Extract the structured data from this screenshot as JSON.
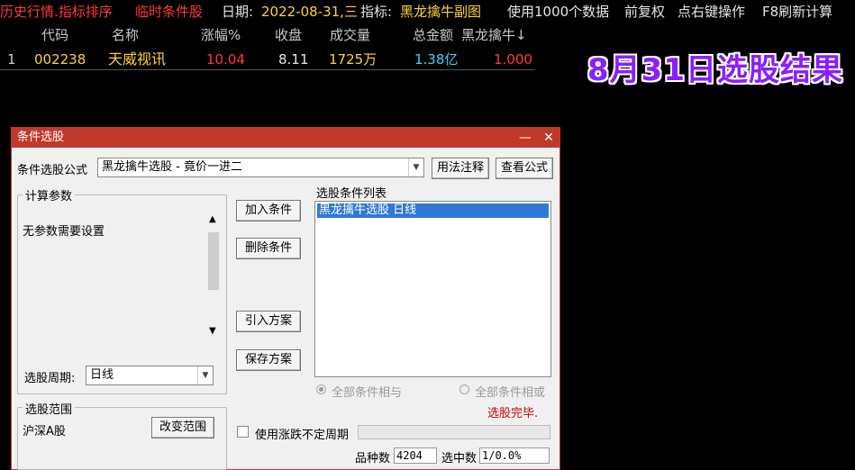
{
  "topbar": {
    "history": "历史行情.指标排序",
    "temp_cond": "临时条件股",
    "date_label": "日期:",
    "date_value": "2022-08-31,三",
    "indicator_label": "指标:",
    "indicator_value": "黑龙擒牛副图",
    "data_count": "使用1000个数据",
    "fq": "前复权",
    "right_click": "点右键操作",
    "f8": "F8刷新计算"
  },
  "table": {
    "headers": [
      "代码",
      "名称",
      "涨幅%",
      "收盘",
      "成交量",
      "总金额",
      "黑龙擒牛↓"
    ],
    "rows": [
      {
        "idx": "1",
        "code": "002238",
        "name": "天威视讯",
        "change": "10.04",
        "close": "8.11",
        "volume": "1725万",
        "amount": "1.38亿",
        "indicator": "1.000"
      }
    ]
  },
  "result_title": "8月31日选股结果",
  "dialog": {
    "title": "条件选股",
    "formula_label": "条件选股公式",
    "formula_value": "黑龙擒牛选股 - 竟价一进二",
    "btn_usage": "用法注释",
    "btn_view": "查看公式",
    "calc_params_label": "计算参数",
    "no_params": "无参数需要设置",
    "period_label": "选股周期:",
    "period_value": "日线",
    "range_label": "选股范围",
    "range_value": "沪深A股",
    "btn_change_range": "改变范围",
    "btn_add": "加入条件",
    "btn_delete": "删除条件",
    "btn_import": "引入方案",
    "btn_save": "保存方案",
    "cond_list_label": "选股条件列表",
    "cond_items": [
      "黑龙擒牛选股   日线"
    ],
    "radio_and": "全部条件相与",
    "radio_or": "全部条件相或",
    "status": "选股完毕.",
    "use_irregular": "使用涨跌不定周期",
    "variety_label": "品种数",
    "variety_value": "4204",
    "selected_label": "选中数",
    "selected_value": "1/0.0%"
  },
  "colors": {
    "titlebar": "#c0392b",
    "selection": "#2f78d6",
    "status": "#cc0000",
    "result_title": "#8a1eff"
  }
}
